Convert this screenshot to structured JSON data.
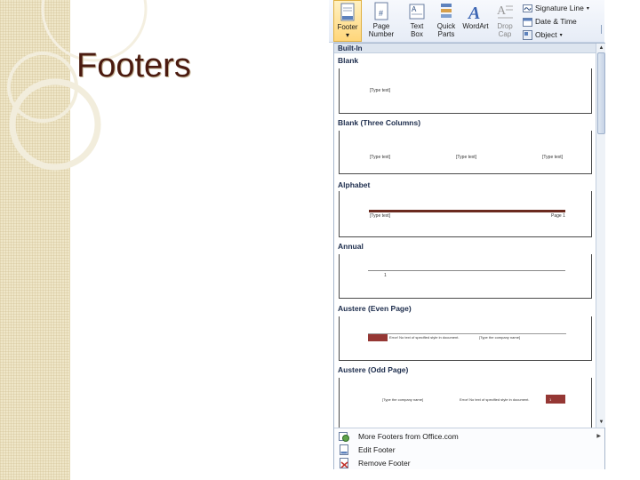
{
  "slide": {
    "title": "Footers"
  },
  "ribbon": {
    "footer_label": "Footer",
    "page_number_label": "Page\nNumber",
    "text_box_label": "Text\nBox",
    "quick_parts_label": "Quick\nParts",
    "wordart_label": "WordArt",
    "drop_cap_label": "Drop\nCap",
    "signature_line_label": "Signature Line",
    "date_time_label": "Date & Time",
    "object_label": "Object"
  },
  "gallery": {
    "header": "Built-In",
    "items": [
      {
        "label": "Blank",
        "placeholders": [
          "[Type text]"
        ]
      },
      {
        "label": "Blank (Three Columns)",
        "placeholders": [
          "[Type text]",
          "[Type text]",
          "[Type text]"
        ]
      },
      {
        "label": "Alphabet",
        "placeholders": [
          "[Type text]",
          "Page 1"
        ]
      },
      {
        "label": "Annual",
        "placeholders": [
          "1"
        ]
      },
      {
        "label": "Austere (Even Page)",
        "placeholders": [
          "Error! No text of specified style in document.",
          "[Type the company name]"
        ]
      },
      {
        "label": "Austere (Odd Page)",
        "placeholders": [
          "[Type the company name]",
          "Error! No text of specified style in document.",
          "1"
        ]
      }
    ]
  },
  "menu": {
    "more_footers": "More Footers from Office.com",
    "edit_footer": "Edit Footer",
    "remove_footer": "Remove Footer"
  },
  "colors": {
    "title": "#4a1a0f",
    "accent_red": "#953734",
    "gallery_header_bg": "#dde5ef"
  }
}
